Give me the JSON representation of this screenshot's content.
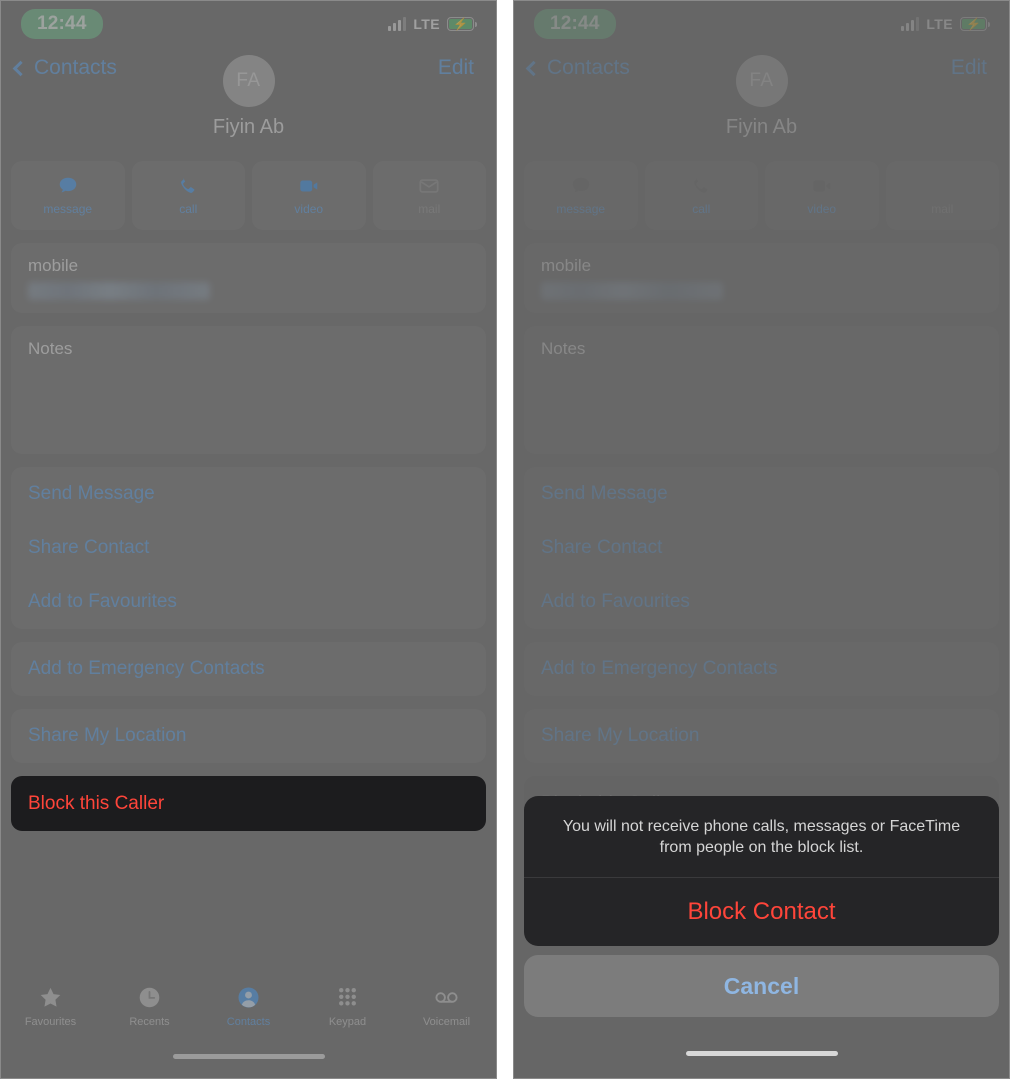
{
  "status_bar": {
    "time": "12:44",
    "network": "LTE",
    "signal_icon": "signal-bars-icon",
    "battery_icon": "battery-charging-icon",
    "time_pill_color": "#6fb388"
  },
  "nav": {
    "back_label": "Contacts",
    "back_icon": "chevron-left-icon",
    "edit_label": "Edit",
    "accent_color": "#5e9ede"
  },
  "contact": {
    "initials": "FA",
    "name": "Fiyin Ab"
  },
  "quick_actions": [
    {
      "label": "message",
      "icon": "message-bubble-icon",
      "enabled": true
    },
    {
      "label": "call",
      "icon": "phone-handset-icon",
      "enabled": true
    },
    {
      "label": "video",
      "icon": "video-camera-icon",
      "enabled": true
    },
    {
      "label": "mail",
      "icon": "envelope-icon",
      "enabled": false
    }
  ],
  "fields": {
    "phone_label": "mobile",
    "phone_value": "",
    "notes_label": "Notes"
  },
  "action_groups": [
    {
      "items": [
        "Send Message",
        "Share Contact",
        "Add to Favourites"
      ]
    },
    {
      "items": [
        "Add to Emergency Contacts"
      ]
    },
    {
      "items": [
        "Share My Location"
      ]
    }
  ],
  "block_button": {
    "label": "Block this Caller",
    "color": "#ff453a",
    "background": "#1c1c1e"
  },
  "tab_bar": [
    {
      "label": "Favourites",
      "icon": "star-icon",
      "active": false
    },
    {
      "label": "Recents",
      "icon": "clock-icon",
      "active": false
    },
    {
      "label": "Contacts",
      "icon": "person-circle-icon",
      "active": true
    },
    {
      "label": "Keypad",
      "icon": "keypad-dots-icon",
      "active": false
    },
    {
      "label": "Voicemail",
      "icon": "voicemail-icon",
      "active": false
    }
  ],
  "action_sheet": {
    "message": "You will not receive phone calls, messages or FaceTime from people on the block list.",
    "confirm_label": "Block Contact",
    "confirm_color": "#ff453a",
    "cancel_label": "Cancel",
    "cancel_color": "#8fb6e2"
  }
}
